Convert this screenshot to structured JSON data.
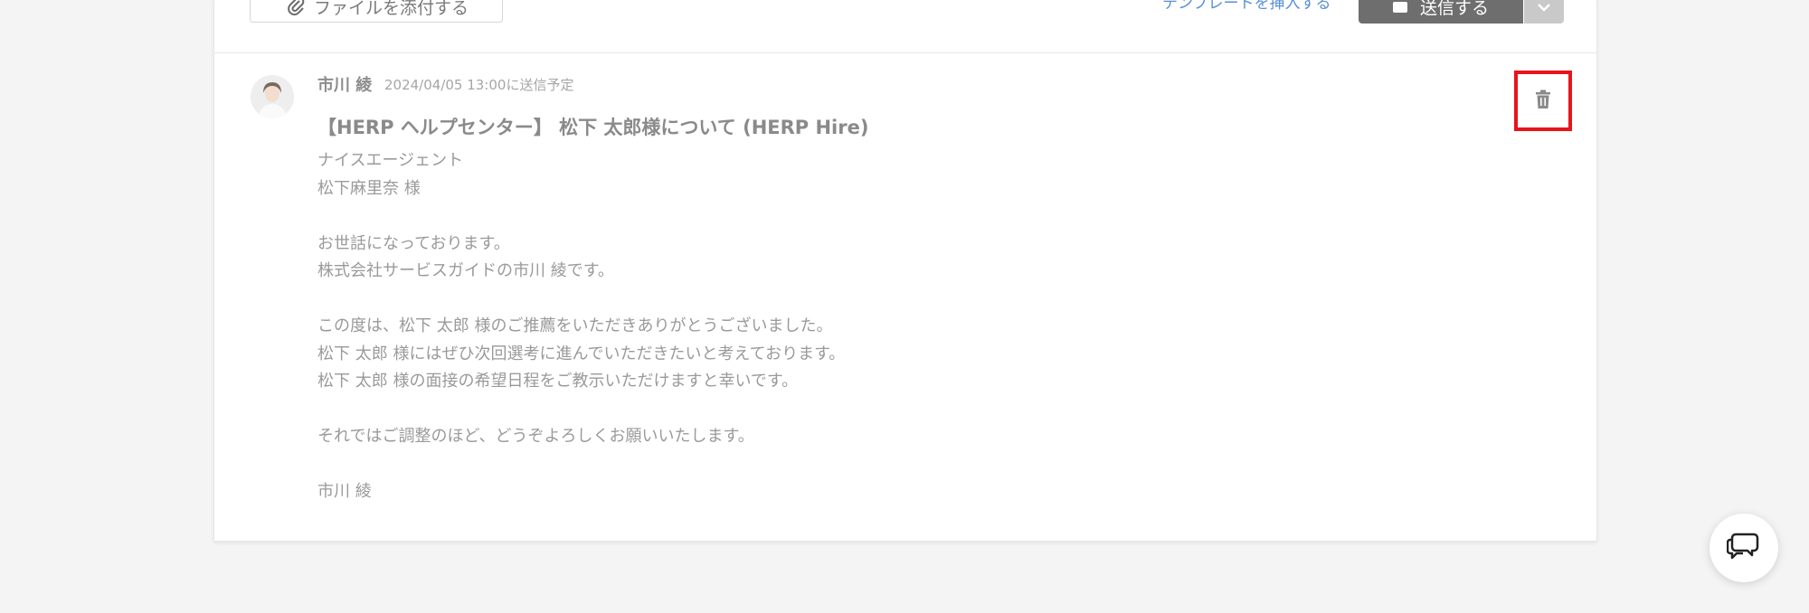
{
  "composer": {
    "attach_label": "ファイルを添付する",
    "template_link": "テンプレートを挿入する",
    "send_label": "送信する"
  },
  "message": {
    "sender": "市川 綾",
    "scheduled": "2024/04/05 13:00に送信予定",
    "subject": "【HERP ヘルプセンター】 松下 太郎様について (HERP Hire)",
    "body_lines": [
      "ナイスエージェント",
      "松下麻里奈 様",
      "",
      "お世話になっております。",
      "株式会社サービスガイドの市川 綾です。",
      "",
      "この度は、松下 太郎 様のご推薦をいただきありがとうございました。",
      "松下 太郎 様にはぜひ次回選考に進んでいただきたいと考えております。",
      "松下 太郎 様の面接の希望日程をご教示いただけますと幸いです。",
      "",
      "それではご調整のほど、どうぞよろしくお願いいたします。",
      "",
      "市川 綾"
    ]
  },
  "icons": {
    "attach": "paperclip-icon",
    "send": "envelope-icon",
    "dropdown": "chevron-down-icon",
    "delete": "trash-icon",
    "chat": "chat-bubbles-icon"
  },
  "colors": {
    "highlight": "#e8141b",
    "link": "#5a8fd8",
    "send_button": "#6e6e6e"
  }
}
